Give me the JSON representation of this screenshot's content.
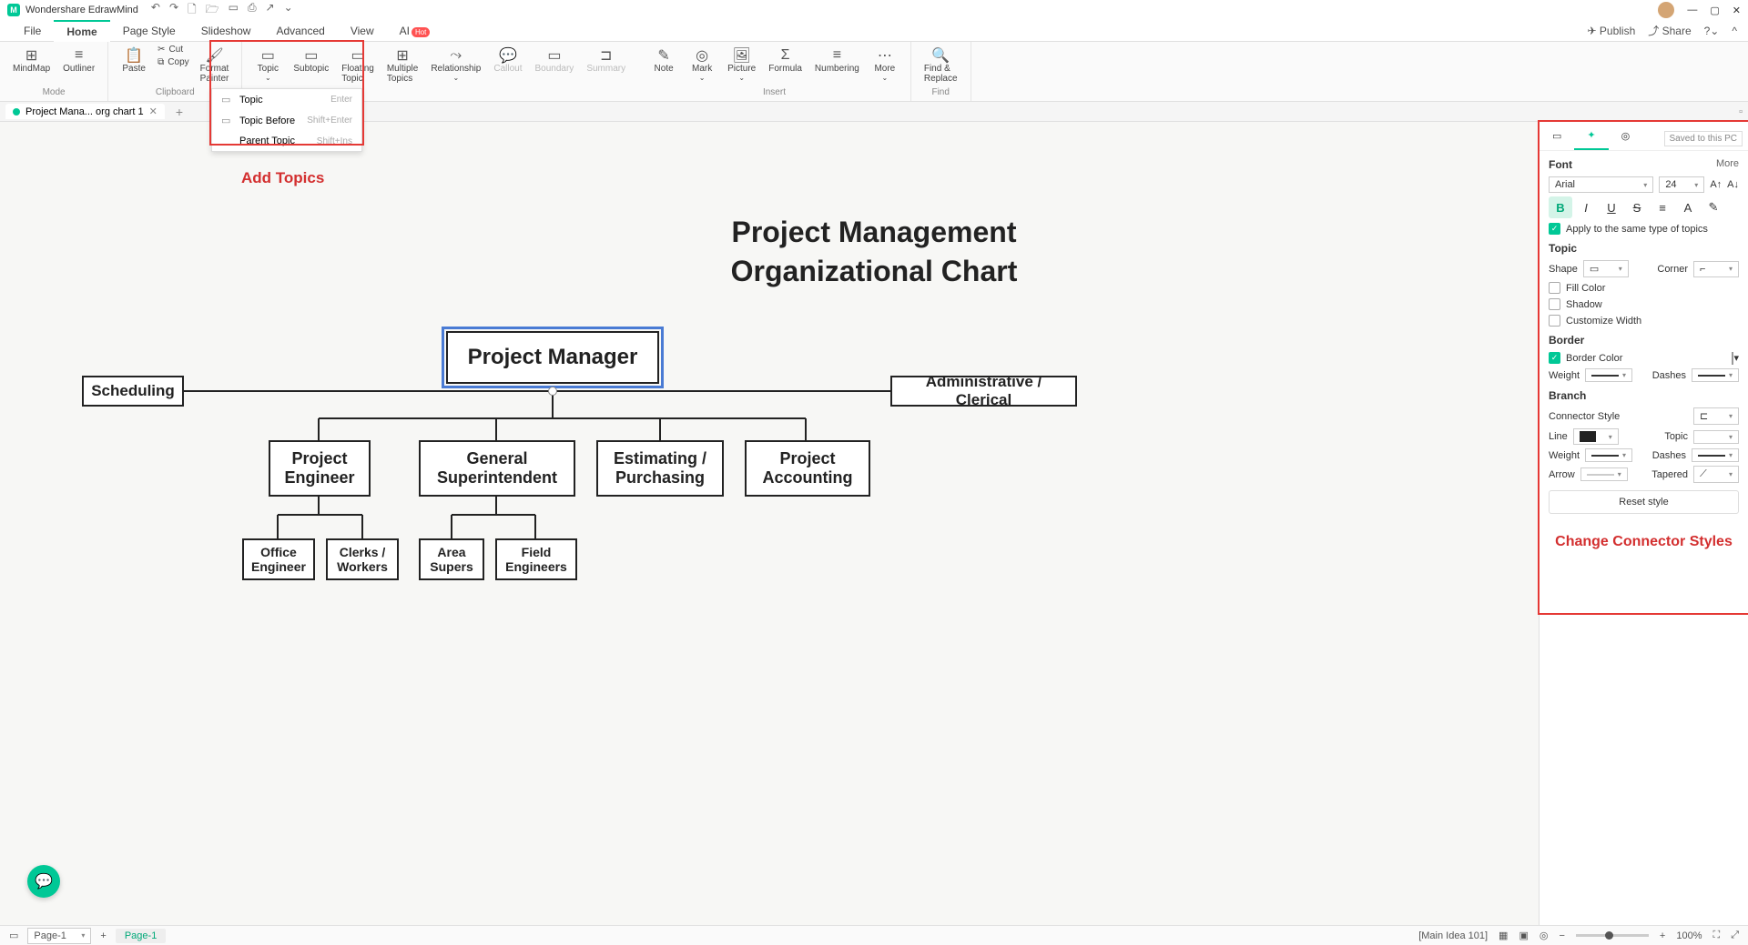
{
  "app_title": "Wondershare EdrawMind",
  "menus": [
    "File",
    "Home",
    "Page Style",
    "Slideshow",
    "Advanced",
    "View",
    "AI"
  ],
  "active_menu": "Home",
  "hot_badge": "Hot",
  "top_right": {
    "publish": "Publish",
    "share": "Share"
  },
  "ribbon": {
    "mode": {
      "label": "Mode",
      "mindmap": "MindMap",
      "outliner": "Outliner"
    },
    "clipboard": {
      "label": "Clipboard",
      "paste": "Paste",
      "cut": "Cut",
      "copy": "Copy",
      "format_painter": "Format\nPainter"
    },
    "topic_group": {
      "topic": "Topic",
      "subtopic": "Subtopic",
      "floating": "Floating\nTopic",
      "multiple": "Multiple\nTopics",
      "relationship": "Relationship",
      "callout": "Callout",
      "boundary": "Boundary",
      "summary": "Summary"
    },
    "insert": {
      "label": "Insert",
      "note": "Note",
      "mark": "Mark",
      "picture": "Picture",
      "formula": "Formula",
      "numbering": "Numbering",
      "more": "More"
    },
    "find": {
      "label": "Find",
      "find_replace": "Find &\nReplace"
    }
  },
  "topic_dropdown": {
    "items": [
      {
        "label": "Topic",
        "shortcut": "Enter"
      },
      {
        "label": "Topic Before",
        "shortcut": "Shift+Enter"
      },
      {
        "label": "Parent Topic",
        "shortcut": "Shift+Ins"
      }
    ]
  },
  "doc_tab": "Project Mana... org chart 1",
  "annotation_add_topics": "Add Topics",
  "chart": {
    "title_line1": "Project Management",
    "title_line2": "Organizational Chart",
    "root": "Project Manager",
    "side_left": "Scheduling",
    "side_right": "Administrative / Clerical",
    "level2": [
      "Project\nEngineer",
      "General\nSuperintendent",
      "Estimating /\nPurchasing",
      "Project\nAccounting"
    ],
    "level3a": [
      "Office\nEngineer",
      "Clerks /\nWorkers"
    ],
    "level3b": [
      "Area\nSupers",
      "Field\nEngineers"
    ]
  },
  "right_panel": {
    "saved": "Saved to this PC",
    "font": {
      "title": "Font",
      "more": "More",
      "family": "Arial",
      "size": "24",
      "apply_same": "Apply to the same type of topics"
    },
    "topic": {
      "title": "Topic",
      "shape": "Shape",
      "corner": "Corner",
      "fill": "Fill Color",
      "shadow": "Shadow",
      "custom_width": "Customize Width"
    },
    "border": {
      "title": "Border",
      "border_color": "Border Color",
      "weight": "Weight",
      "dashes": "Dashes"
    },
    "branch": {
      "title": "Branch",
      "connector": "Connector Style",
      "line": "Line",
      "topic": "Topic",
      "weight": "Weight",
      "dashes": "Dashes",
      "arrow": "Arrow",
      "tapered": "Tapered",
      "reset": "Reset style"
    },
    "annotation": "Change Connector Styles"
  },
  "status": {
    "page_select": "Page-1",
    "page_tab": "Page-1",
    "main_idea": "[Main Idea 101]",
    "zoom": "100%"
  }
}
